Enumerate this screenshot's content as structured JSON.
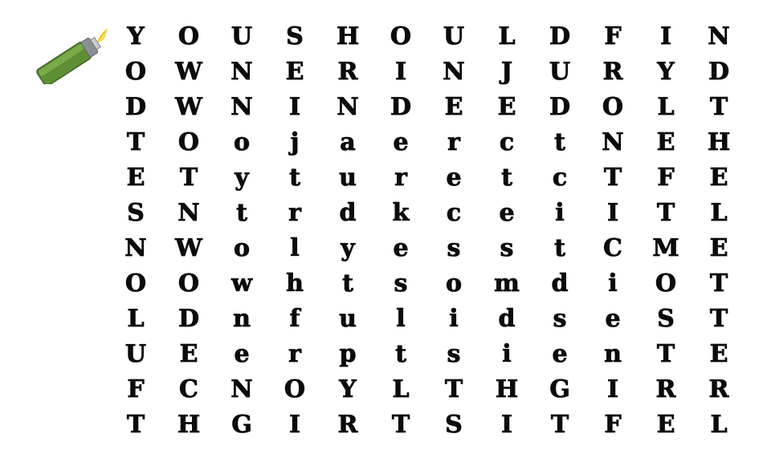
{
  "puzzle": {
    "rows": [
      [
        "Y",
        "O",
        "U",
        "S",
        "H",
        "O",
        "U",
        "L",
        "D",
        "F",
        "I",
        "N"
      ],
      [
        "O",
        "W",
        "N",
        "E",
        "R",
        "I",
        "N",
        "J",
        "U",
        "R",
        "Y",
        "D"
      ],
      [
        "D",
        "W",
        "N",
        "I",
        "N",
        "D",
        "E",
        "E",
        "D",
        "O",
        "L",
        "T"
      ],
      [
        "T",
        "O",
        "o",
        "j",
        "a",
        "e",
        "r",
        "c",
        "t",
        "N",
        "E",
        "H"
      ],
      [
        "E",
        "T",
        "y",
        "t",
        "u",
        "r",
        "e",
        "t",
        "c",
        "T",
        "F",
        "E"
      ],
      [
        "S",
        "N",
        "t",
        "r",
        "d",
        "k",
        "c",
        "e",
        "i",
        "I",
        "T",
        "L"
      ],
      [
        "N",
        "W",
        "o",
        "l",
        "y",
        "e",
        "s",
        "s",
        "t",
        "C",
        "M",
        "E"
      ],
      [
        "O",
        "O",
        "w",
        "h",
        "t",
        "s",
        "o",
        "m",
        "d",
        "i",
        "O",
        "T"
      ],
      [
        "L",
        "D",
        "n",
        "f",
        "u",
        "l",
        "i",
        "d",
        "s",
        "e",
        "S",
        "T"
      ],
      [
        "U",
        "E",
        "e",
        "r",
        "p",
        "t",
        "s",
        "i",
        "e",
        "n",
        "T",
        "E"
      ],
      [
        "F",
        "C",
        "N",
        "O",
        "Y",
        "L",
        "T",
        "H",
        "G",
        "I",
        "R",
        "R"
      ],
      [
        "T",
        "H",
        "G",
        "I",
        "R",
        "T",
        "S",
        "I",
        "T",
        "F",
        "E",
        "L"
      ]
    ]
  },
  "decoration": {
    "icon": "lighter-icon",
    "body_color": "#6b9a3c",
    "flame_color": "#f5c400"
  }
}
